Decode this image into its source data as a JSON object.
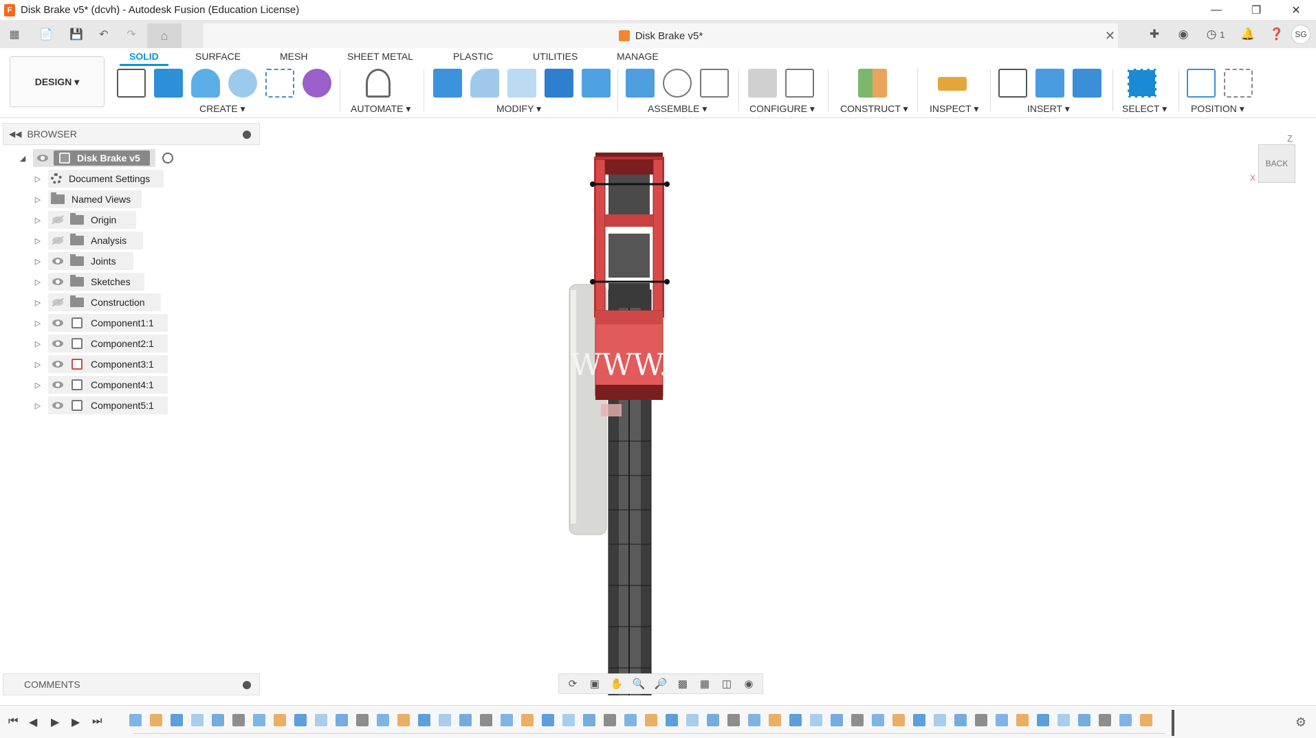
{
  "window": {
    "title": "Disk Brake v5* (dcvh) - Autodesk Fusion (Education License)",
    "app_icon": "F"
  },
  "doc_tab": {
    "label": "Disk Brake v5*",
    "close": "✕"
  },
  "account": {
    "initials": "SG",
    "jobs_count": "1"
  },
  "workspace": {
    "label": "DESIGN ▾"
  },
  "ribbon_tabs": [
    "SOLID",
    "SURFACE",
    "MESH",
    "SHEET METAL",
    "PLASTIC",
    "UTILITIES",
    "MANAGE"
  ],
  "ribbon_groups": [
    "CREATE ▾",
    "AUTOMATE ▾",
    "MODIFY ▾",
    "ASSEMBLE ▾",
    "CONFIGURE ▾",
    "CONSTRUCT ▾",
    "INSPECT ▾",
    "INSERT ▾",
    "SELECT ▾",
    "POSITION ▾"
  ],
  "browser": {
    "title": "BROWSER",
    "root": "Disk Brake v5",
    "items": [
      {
        "label": "Document Settings",
        "icon": "gear-icon"
      },
      {
        "label": "Named Views",
        "icon": "folder-icon"
      },
      {
        "label": "Origin",
        "icon": "folder-icon",
        "visible": false
      },
      {
        "label": "Analysis",
        "icon": "folder-icon",
        "visible": false
      },
      {
        "label": "Joints",
        "icon": "folder-icon",
        "visible": true
      },
      {
        "label": "Sketches",
        "icon": "folder-icon",
        "visible": true
      },
      {
        "label": "Construction",
        "icon": "folder-icon",
        "visible": false
      },
      {
        "label": "Component1:1",
        "icon": "component-icon",
        "visible": true
      },
      {
        "label": "Component2:1",
        "icon": "component-icon",
        "visible": true
      },
      {
        "label": "Component3:1",
        "icon": "component-icon",
        "visible": true
      },
      {
        "label": "Component4:1",
        "icon": "component-icon",
        "visible": true
      },
      {
        "label": "Component5:1",
        "icon": "component-icon",
        "visible": true
      }
    ]
  },
  "viewcube": {
    "face": "BACK",
    "axis_z": "Z",
    "axis_x": "X"
  },
  "viewport_overlay": "WWW.",
  "comments": {
    "title": "COMMENTS"
  },
  "colors": {
    "accent": "#0696d7",
    "caliper_red": "#d84a4a",
    "disc_dark": "#3c3c3c"
  }
}
